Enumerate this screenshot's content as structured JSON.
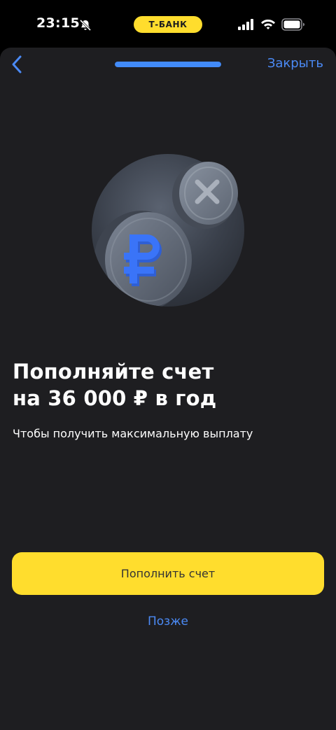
{
  "status_bar": {
    "time": "23:15",
    "bank_label": "Т-БАНК",
    "icons": [
      "bell-off-icon",
      "cellular-signal-icon",
      "wifi-icon",
      "battery-icon"
    ]
  },
  "header": {
    "back_icon": "chevron-left-icon",
    "close_label": "Закрыть",
    "step_progress": 1.0
  },
  "hero": {
    "icons": [
      "ruble-coin-icon",
      "cross-coin-icon"
    ]
  },
  "content": {
    "title_line1": "Пополняйте счет",
    "title_line2": "на 36 000 ₽ в год",
    "subtitle": "Чтобы получить максимальную выплату"
  },
  "actions": {
    "primary_label": "Пополнить счет",
    "secondary_label": "Позже"
  },
  "colors": {
    "accent_yellow": "#ffdd2d",
    "link_blue": "#4b8af5",
    "sheet_background": "#1e1e21",
    "ruble_blue": "#3a6ff7"
  }
}
